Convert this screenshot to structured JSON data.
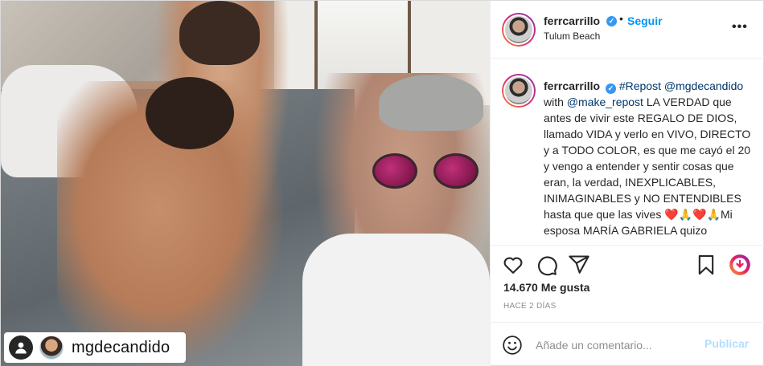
{
  "post": {
    "author": "ferrcarrillo",
    "follow_label": "Seguir",
    "dot": "•",
    "location": "Tulum Beach",
    "more_label": "•••"
  },
  "photo": {
    "tagged_user": "mgdecandido"
  },
  "caption": {
    "username": "ferrcarrillo",
    "hashtag": "#Repost",
    "mention_1": "@mgdecandido",
    "with_word": "with",
    "mention_2": "@make_repost",
    "text_1": "LA VERDAD que antes de vivir este REGALO DE DIOS, llamado VIDA y verlo en VIVO, DIRECTO y a TODO COLOR, es que me cayó el 20 y vengo a entender y sentir cosas que eran, la verdad, INEXPLICABLES, INIMAGINABLES y NO ENTENDIBLES hasta que que las vives",
    "emojis": "❤️🙏❤️🙏",
    "text_2": "Mi esposa MARÍA GABRIELA quizo"
  },
  "actions": {
    "icons": [
      "heart-icon",
      "comment-icon",
      "share-icon",
      "bookmark-icon",
      "repost-app-icon"
    ]
  },
  "stats": {
    "likes": "14.670 Me gusta",
    "time": "HACE 2 DÍAS"
  },
  "comment": {
    "placeholder": "Añade un comentario...",
    "publish_label": "Publicar"
  },
  "colors": {
    "link": "#00376b",
    "follow": "#0095f6",
    "publish_disabled": "#b2dffc",
    "verified": "#3897f0"
  }
}
